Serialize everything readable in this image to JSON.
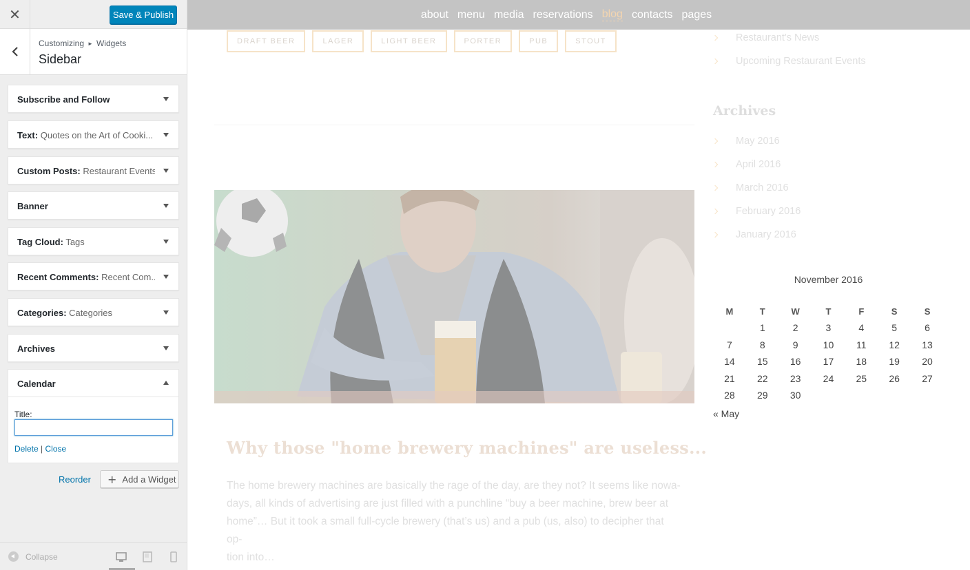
{
  "header": {
    "close_glyph": "✕",
    "publish_label": "Save & Publish"
  },
  "section": {
    "crumb_root": "Customizing",
    "crumb_child": "Widgets",
    "title": "Sidebar"
  },
  "widgets": [
    {
      "name": "Subscribe and Follow",
      "sub": ""
    },
    {
      "name": "Text:",
      "sub": "Quotes on the Art of Cooki..."
    },
    {
      "name": "Custom Posts:",
      "sub": "Restaurant Events"
    },
    {
      "name": "Banner",
      "sub": ""
    },
    {
      "name": "Tag Cloud:",
      "sub": "Tags"
    },
    {
      "name": "Recent Comments:",
      "sub": "Recent Com..."
    },
    {
      "name": "Categories:",
      "sub": "Categories"
    },
    {
      "name": "Archives",
      "sub": ""
    }
  ],
  "open_widget": {
    "name": "Calendar",
    "field_label": "Title:",
    "field_value": "",
    "delete": "Delete",
    "separator": "|",
    "close": "Close"
  },
  "actions": {
    "reorder": "Reorder",
    "add_widget": "Add a Widget"
  },
  "footer": {
    "collapse": "Collapse",
    "devices": [
      "desktop-icon",
      "tablet-icon",
      "mobile-icon"
    ]
  },
  "preview": {
    "nav": [
      "about",
      "menu",
      "media",
      "reservations",
      "blog",
      "contacts",
      "pages"
    ],
    "nav_active": "blog",
    "tags": [
      "DRAFT BEER",
      "LAGER",
      "LIGHT BEER",
      "PORTER",
      "PUB",
      "STOUT"
    ],
    "categories": [
      "Restaurant's News",
      "Upcoming Restaurant Events"
    ],
    "archives_title": "Archives",
    "archives": [
      "May 2016",
      "April 2016",
      "March 2016",
      "February 2016",
      "January 2016"
    ],
    "post_title": "Why those \"home brewery machines\" are useless...",
    "post_lines": [
      "The home brewery machines are basically the rage of the day, are they not? It seems like nowa-",
      "days, all kinds of advertising are just filled with a punchline “buy a beer machine, brew beer at",
      "home”… But it took a small full-cycle brewery (that’s us) and a pub (us, also) to decipher that op-",
      "tion into…"
    ],
    "calendar": {
      "caption": "November 2016",
      "days": [
        "M",
        "T",
        "W",
        "T",
        "F",
        "S",
        "S"
      ],
      "weeks": [
        [
          "",
          "1",
          "2",
          "3",
          "4",
          "5",
          "6"
        ],
        [
          "7",
          "8",
          "9",
          "10",
          "11",
          "12",
          "13"
        ],
        [
          "14",
          "15",
          "16",
          "17",
          "18",
          "19",
          "20"
        ],
        [
          "21",
          "22",
          "23",
          "24",
          "25",
          "26",
          "27"
        ],
        [
          "28",
          "29",
          "30",
          "",
          "",
          "",
          ""
        ]
      ],
      "prev": "« May"
    }
  },
  "colors": {
    "primary": "#0085ba",
    "link": "#0073aa",
    "nav_bg": "#c4c4c4",
    "nav_active": "#f3d5b0",
    "tag_border": "#f6e3c8"
  }
}
